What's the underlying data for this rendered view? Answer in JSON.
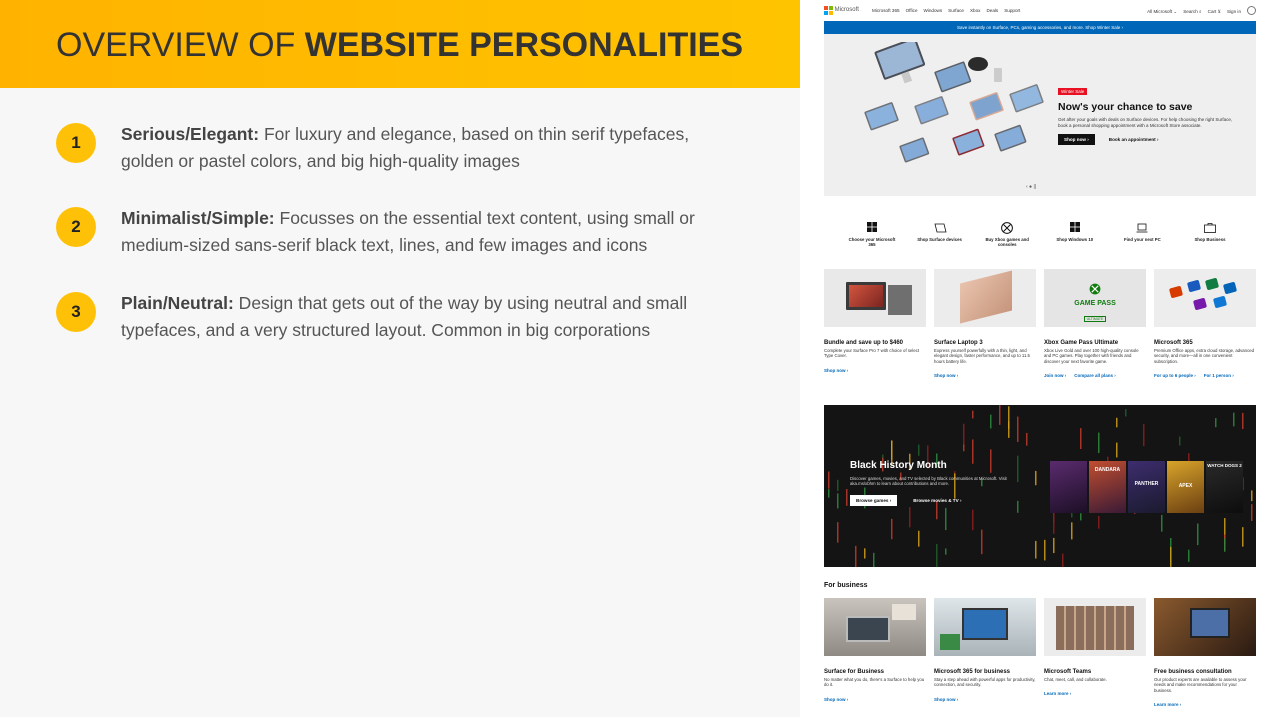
{
  "slide": {
    "title_thin": "OVERVIEW OF ",
    "title_bold": "WEBSITE PERSONALITIES",
    "points": [
      {
        "num": "1",
        "label": "Serious/Elegant:",
        "text": " For luxury and elegance, based on thin serif typefaces, golden or pastel colors, and big high-quality images"
      },
      {
        "num": "2",
        "label": "Minimalist/Simple:",
        "text": " Focusses on the essential text content, using small or medium-sized sans-serif black text, lines, and few images and icons"
      },
      {
        "num": "3",
        "label": "Plain/Neutral:",
        "text": " Design that gets out of the way by using neutral and small typefaces, and a very structured layout. Common in big corporations"
      }
    ]
  },
  "site": {
    "logo": "Microsoft",
    "nav": [
      "Microsoft 365",
      "Office",
      "Windows",
      "Surface",
      "Xbox",
      "Deals",
      "Support"
    ],
    "nav_right": {
      "all": "All Microsoft ⌄",
      "search": "Search ⌕",
      "cart": "Cart ⊻",
      "signin": "Sign in"
    },
    "promo": "Save instantly on Surface, PCs, gaming accessories, and more. Shop Winter Sale  ›",
    "hero": {
      "eyebrow": "Winter Sale",
      "title": "Now's your chance to save",
      "desc": "Get after your goals with deals on Surface devices. For help choosing the right Surface, book a personal shopping appointment with a Microsoft Store associate.",
      "cta_primary": "Shop now  ›",
      "cta_secondary": "Book an appointment  ›",
      "dots": "‹ ●  ||"
    },
    "quick_links": [
      {
        "icon": "windows-grid-icon",
        "label": "Choose your Microsoft 365"
      },
      {
        "icon": "surface-device-icon",
        "label": "Shop Surface devices"
      },
      {
        "icon": "xbox-logo-icon",
        "label": "Buy Xbox games and consoles"
      },
      {
        "icon": "windows-logo-icon",
        "label": "Shop Windows 10"
      },
      {
        "icon": "laptop-icon",
        "label": "Find your next PC"
      },
      {
        "icon": "briefcase-icon",
        "label": "Shop Business"
      }
    ],
    "cards": [
      {
        "title": "Bundle and save up to $460",
        "desc": "Complete your Surface Pro 7 with choice of select Type Cover.",
        "links": [
          "Shop now  ›"
        ]
      },
      {
        "title": "Surface Laptop 3",
        "desc": "Express yourself powerfully with a thin, light, and elegant design, faster performance, and up to 11.5 hours battery life.",
        "links": [
          "Shop now  ›"
        ]
      },
      {
        "title": "Xbox Game Pass Ultimate",
        "desc": "Xbox Live Gold and over 100 high-quality console and PC games. Play together with friends and discover your next favorite game.",
        "links": [
          "Join now  ›",
          "Compare all plans  ›"
        ],
        "img_text": "GAME PASS",
        "img_sub": "ULTIMATE"
      },
      {
        "title": "Microsoft 365",
        "desc": "Premium Office apps, extra cloud storage, advanced security, and more—all in one convenient subscription.",
        "links": [
          "For up to 6 people  ›",
          "For 1 person  ›"
        ]
      }
    ],
    "bhm": {
      "title": "Black History Month",
      "desc": "Discover games, movies, and TV selected by Black communities at Microsoft. Visit aka.ms/xbhm to learn about contributions and more.",
      "cta_primary": "Browse games  ›",
      "cta_secondary": "Browse movies & TV  ›",
      "posters": [
        "",
        "DANDARA",
        "PANTHER",
        "APEX",
        "WATCH DOGS 2"
      ]
    },
    "business_heading": "For business",
    "biz_cards": [
      {
        "title": "Surface for Business",
        "desc": "No matter what you do, there's a Surface to help you do it.",
        "links": [
          "Shop now  ›"
        ]
      },
      {
        "title": "Microsoft 365 for business",
        "desc": "Stay a step ahead with powerful apps for productivity, connection, and security.",
        "links": [
          "Shop now  ›"
        ]
      },
      {
        "title": "Microsoft Teams",
        "desc": "Chat, meet, call, and collaborate.",
        "links": [
          "Learn more  ›"
        ]
      },
      {
        "title": "Free business consultation",
        "desc": "Our product experts are available to assess your needs and make recommendations for your business.",
        "links": [
          "Learn more  ›"
        ]
      }
    ],
    "colors": {
      "accent": "#ffc107",
      "ms_blue": "#0067b8",
      "sale_red": "#e81123"
    }
  }
}
